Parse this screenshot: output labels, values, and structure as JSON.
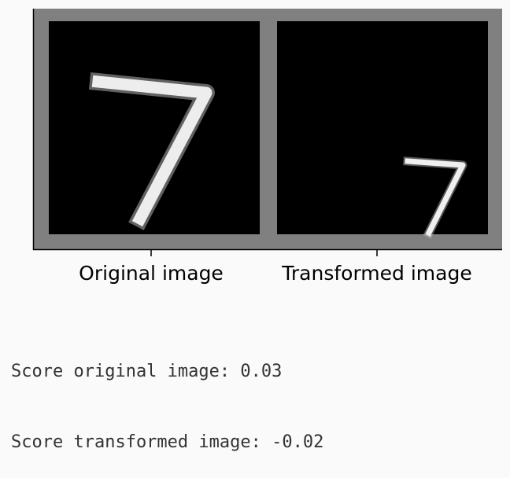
{
  "figure": {
    "panels": [
      {
        "label": "Original image",
        "digit": "7",
        "variant": "original"
      },
      {
        "label": "Transformed image",
        "digit": "7",
        "variant": "transformed"
      }
    ],
    "colors": {
      "frame": "#808080",
      "digit_bg": "#000000",
      "stroke": "#ffffff",
      "axes": "#000000"
    }
  },
  "output": {
    "score_original": "Score original image: 0.03",
    "score_transformed": "Score transformed image: -0.02"
  }
}
